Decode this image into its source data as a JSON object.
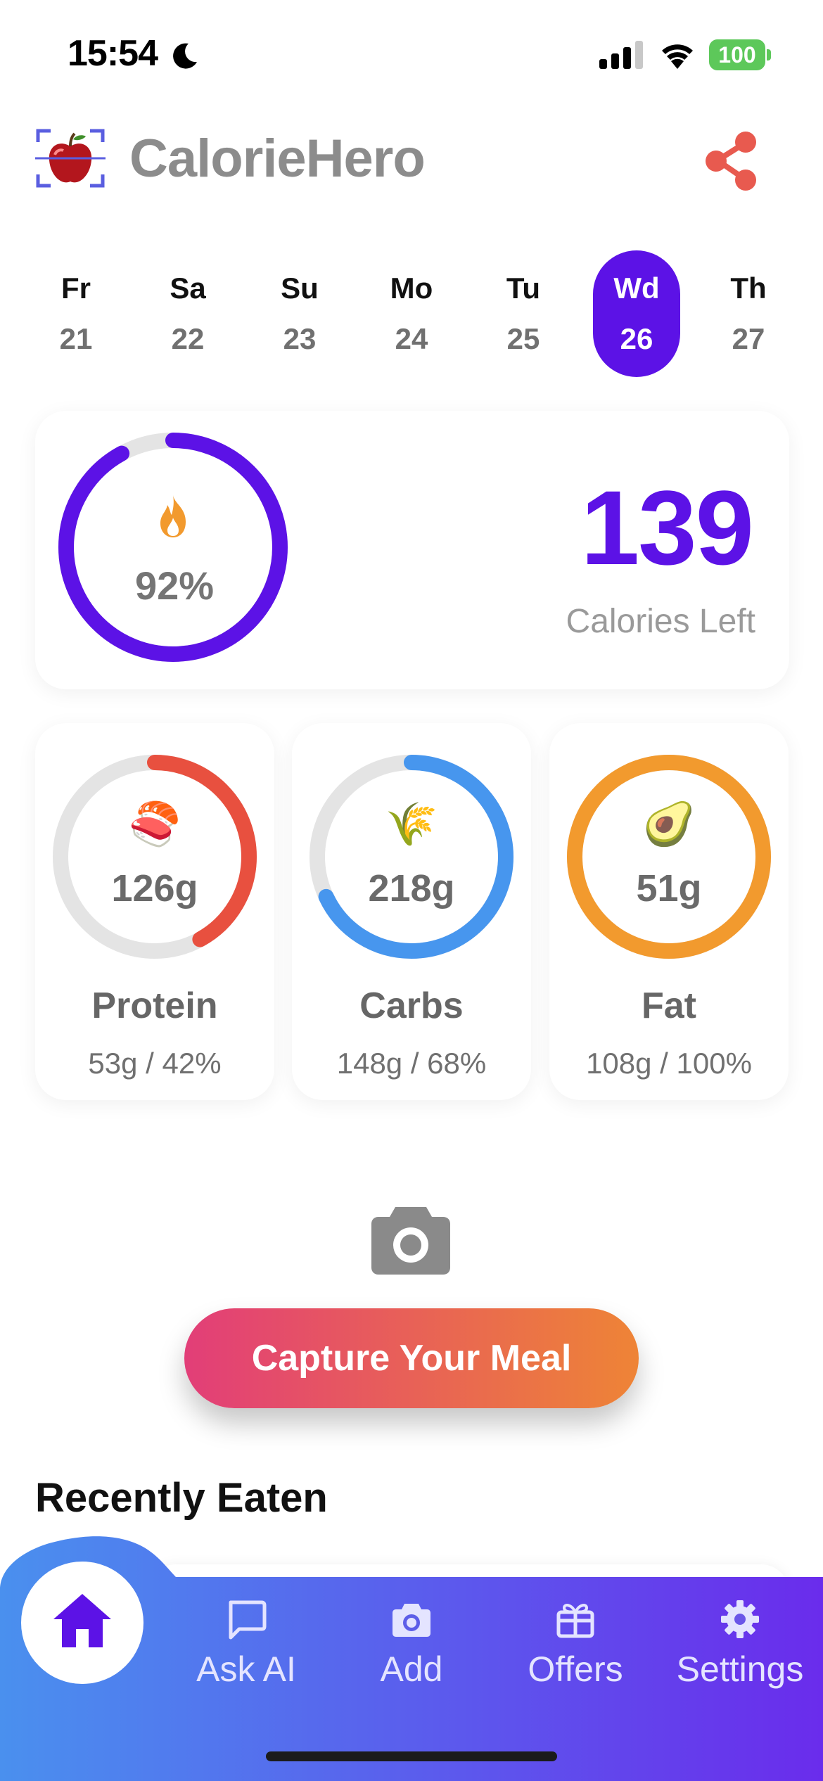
{
  "status_bar": {
    "time": "15:54",
    "battery": "100"
  },
  "header": {
    "title": "CalorieHero"
  },
  "week": [
    {
      "name": "Fr",
      "num": "21",
      "active": false
    },
    {
      "name": "Sa",
      "num": "22",
      "active": false
    },
    {
      "name": "Su",
      "num": "23",
      "active": false
    },
    {
      "name": "Mo",
      "num": "24",
      "active": false
    },
    {
      "name": "Tu",
      "num": "25",
      "active": false
    },
    {
      "name": "Wd",
      "num": "26",
      "active": true
    },
    {
      "name": "Th",
      "num": "27",
      "active": false
    }
  ],
  "calories": {
    "percent_label": "92%",
    "progress": 0.92,
    "left": "139",
    "left_label": "Calories Left",
    "ring_color": "#5c12e6"
  },
  "macros": [
    {
      "emoji": "🍣",
      "icon": "salmon-icon",
      "value": "126g",
      "name": "Protein",
      "detail": "53g / 42%",
      "progress": 0.42,
      "color": "#e8503f"
    },
    {
      "emoji": "🌾",
      "icon": "wheat-icon",
      "value": "218g",
      "name": "Carbs",
      "detail": "148g / 68%",
      "progress": 0.68,
      "color": "#4796ee"
    },
    {
      "emoji": "🥑",
      "icon": "avocado-icon",
      "value": "51g",
      "name": "Fat",
      "detail": "108g / 100%",
      "progress": 1.0,
      "color": "#f29a2e"
    }
  ],
  "capture": {
    "label": "Capture Your Meal"
  },
  "recent": {
    "title": "Recently Eaten"
  },
  "nav": {
    "home": "home-icon",
    "items": [
      {
        "label": "Ask AI",
        "icon": "chat-icon"
      },
      {
        "label": "Add",
        "icon": "camera-icon"
      },
      {
        "label": "Offers",
        "icon": "gift-icon"
      },
      {
        "label": "Settings",
        "icon": "gear-icon"
      }
    ]
  },
  "colors": {
    "accent": "#5c12e6",
    "capture_start": "#e23e78",
    "capture_end": "#ee8436",
    "nav_start": "#4a90ee",
    "nav_end": "#6a2cec"
  }
}
